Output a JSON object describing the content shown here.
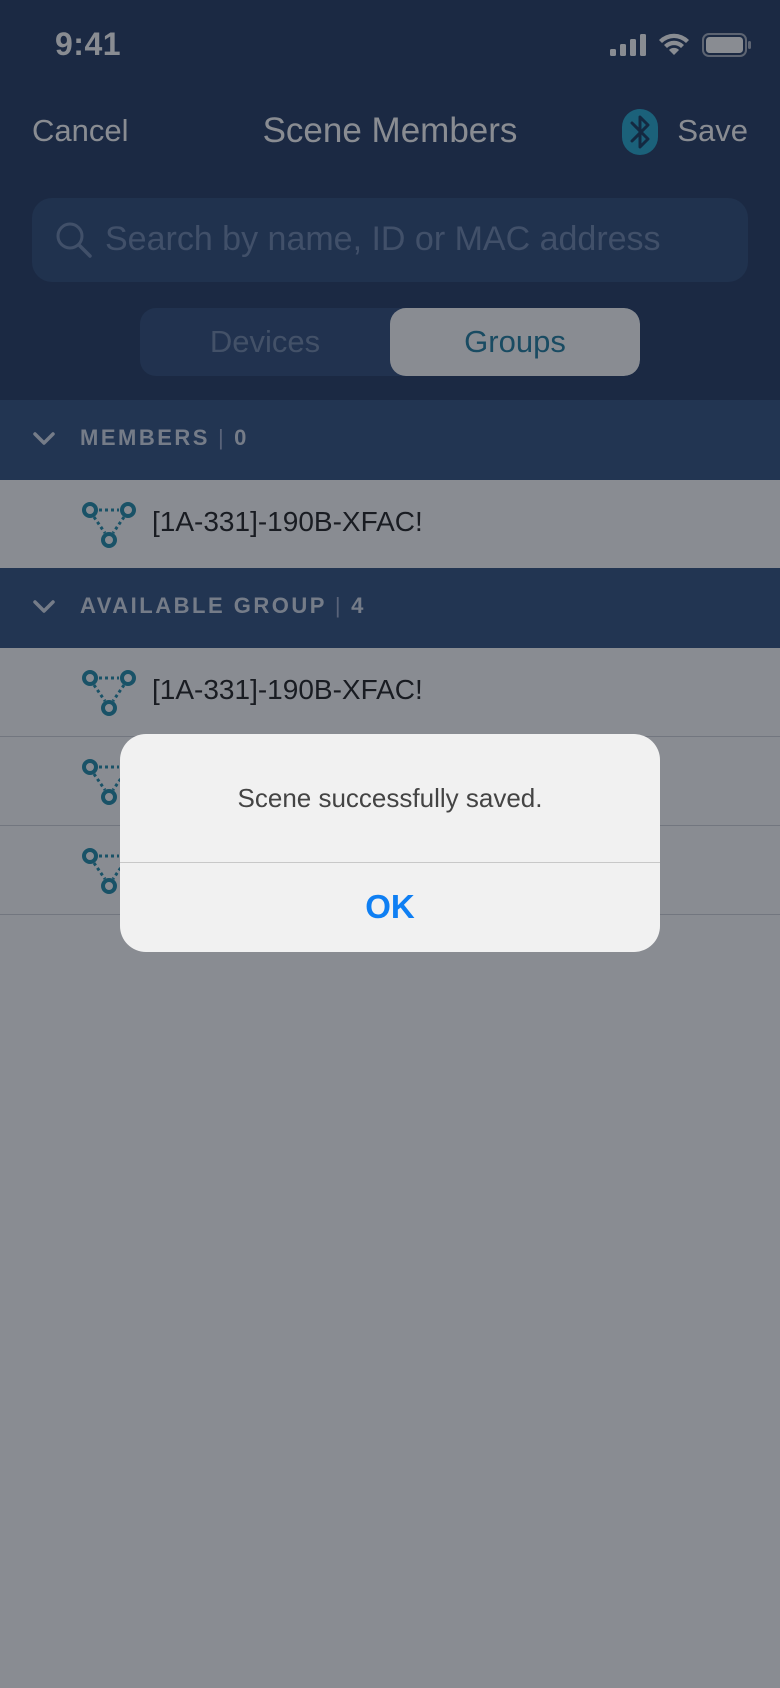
{
  "status_bar": {
    "time": "9:41"
  },
  "nav": {
    "cancel_label": "Cancel",
    "title": "Scene Members",
    "save_label": "Save"
  },
  "search": {
    "placeholder": "Search by name, ID or MAC address"
  },
  "segments": {
    "devices_label": "Devices",
    "groups_label": "Groups",
    "selected": "Groups"
  },
  "members_section": {
    "title": "MEMBERS",
    "separator": "|",
    "count": "0",
    "items": [
      {
        "label": "[1A-331]-190B-XFAC!"
      }
    ]
  },
  "available_section": {
    "title": "AVAILABLE GROUP",
    "separator": "|",
    "count": "4",
    "items": [
      {
        "label": "[1A-331]-190B-XFAC!"
      },
      {
        "label": ""
      },
      {
        "label": ""
      }
    ]
  },
  "alert": {
    "message": "Scene successfully saved.",
    "ok_label": "OK"
  },
  "colors": {
    "header_bg": "#223960",
    "section_bg": "#30507f",
    "accent": "#1f7c9f",
    "alert_button": "#0f7ff3"
  },
  "icons": {
    "group_icon": "group-network-icon",
    "search": "search-icon",
    "bluetooth": "bluetooth-icon",
    "chevron": "chevron-down-icon"
  }
}
